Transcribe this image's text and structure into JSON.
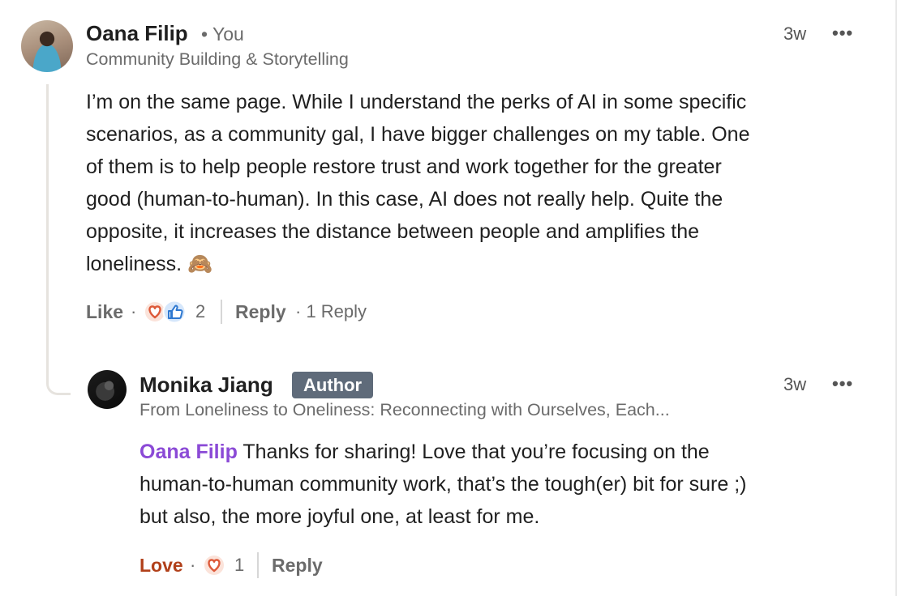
{
  "comment": {
    "author": "Oana Filip",
    "you_label": "• You",
    "subtitle": "Community Building & Storytelling",
    "time": "3w",
    "more": "•••",
    "lines": [
      "I’m on the same page. While I understand the perks of AI in some specific",
      "scenarios, as a community gal, I have bigger challenges on my table. One",
      "of them is to help people restore trust and work together for the greater",
      "good (human-to-human). In this case, AI does not really help. Quite the",
      "opposite, it increases the distance between people and amplifies the",
      "loneliness. 🙈"
    ],
    "like_label": "Like",
    "dot": "·",
    "reaction_count": "2",
    "reply_label": "Reply",
    "replies_count_label": "· 1 Reply",
    "icons": [
      "heart-reaction-icon",
      "thumbs-up-reaction-icon"
    ]
  },
  "reply": {
    "author": "Monika Jiang",
    "badge": "Author",
    "subtitle": "From Loneliness to Oneliness: Reconnecting with Ourselves, Each...",
    "time": "3w",
    "more": "•••",
    "mention": "Oana Filip",
    "line1_rest": " Thanks for sharing! Love that you’re focusing on the",
    "line2": "human-to-human community work, that’s the tough(er) bit for sure ;)",
    "line3": "but also, the more joyful one, at least for me.",
    "love_label": "Love",
    "dot": "·",
    "reaction_count": "1",
    "reply_label": "Reply",
    "icons": [
      "heart-reaction-icon"
    ]
  },
  "colors": {
    "mention": "#8b4ad6",
    "love": "#b1401a",
    "badge_bg": "#5f6b7a",
    "heart": "#dd5a3a",
    "like": "#2e78d0"
  }
}
